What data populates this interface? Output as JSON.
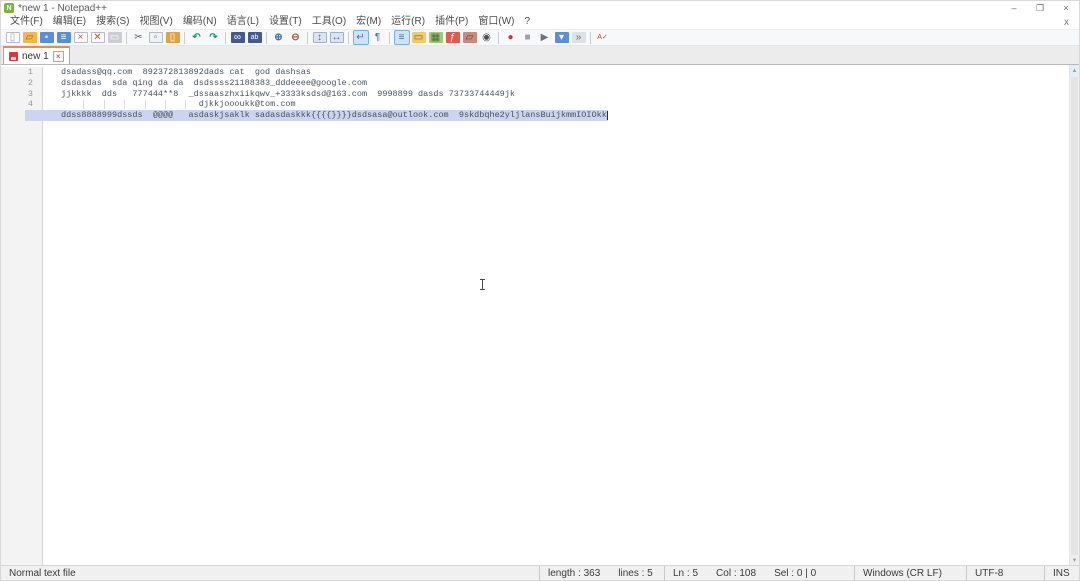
{
  "window": {
    "title": "*new 1 - Notepad++",
    "controls": {
      "minimize": "–",
      "restore": "❐",
      "close": "×"
    }
  },
  "menubar": {
    "items": [
      {
        "id": "file",
        "label": "文件(F)"
      },
      {
        "id": "edit",
        "label": "编辑(E)"
      },
      {
        "id": "search",
        "label": "搜索(S)"
      },
      {
        "id": "view",
        "label": "视图(V)"
      },
      {
        "id": "encoding",
        "label": "编码(N)"
      },
      {
        "id": "language",
        "label": "语言(L)"
      },
      {
        "id": "settings",
        "label": "设置(T)"
      },
      {
        "id": "tools",
        "label": "工具(O)"
      },
      {
        "id": "macro",
        "label": "宏(M)"
      },
      {
        "id": "run",
        "label": "运行(R)"
      },
      {
        "id": "plugins",
        "label": "插件(P)"
      },
      {
        "id": "window",
        "label": "窗口(W)"
      },
      {
        "id": "help",
        "label": "?"
      }
    ],
    "doc_close": "x"
  },
  "toolbar": {
    "pressed_bg": "#cfe3f7",
    "pressed_border": "#7ab0e0",
    "icons": [
      {
        "id": "new-file",
        "glyph": "▯",
        "fg": "#9aa1ab",
        "bg": "#fdfdfd",
        "border": "#b6bcc6"
      },
      {
        "id": "open-folder",
        "glyph": "▱",
        "fg": "#8a6420",
        "bg": "#f3b64c"
      },
      {
        "id": "save",
        "glyph": "▪",
        "fg": "#cfe0f5",
        "bg": "#5b8dd9",
        "disabled": false
      },
      {
        "id": "save-all",
        "glyph": "≡",
        "fg": "#ffffff",
        "bg": "#5b8dd9"
      },
      {
        "id": "close",
        "glyph": "×",
        "fg": "#d44a3a",
        "bg": "#fdfdfd",
        "border": "#b6bcc6"
      },
      {
        "id": "close-all",
        "glyph": "✕",
        "fg": "#d44a3a",
        "bg": "#fdfdfd",
        "border": "#b6bcc6"
      },
      {
        "id": "print",
        "glyph": "▭",
        "fg": "#ffffff",
        "bg": "#c9cdd4"
      },
      {
        "sep": true
      },
      {
        "id": "cut",
        "glyph": "✂",
        "fg": "#5a6068"
      },
      {
        "id": "copy",
        "glyph": "▫",
        "fg": "#7a828c",
        "bg": "#eef2f7",
        "border": "#b6bcc6"
      },
      {
        "id": "paste",
        "glyph": "▯",
        "fg": "#ffffff",
        "bg": "#e2a23f"
      },
      {
        "sep": true
      },
      {
        "id": "undo",
        "glyph": "↶",
        "fg": "#1c9e63",
        "bold": true
      },
      {
        "id": "redo",
        "glyph": "↷",
        "fg": "#1c9e63",
        "bold": true
      },
      {
        "sep": true
      },
      {
        "id": "find",
        "glyph": "∞",
        "fg": "#ffffff",
        "bg": "#44598f"
      },
      {
        "id": "replace",
        "glyph": "ab",
        "fg": "#ffffff",
        "bg": "#44598f",
        "small": true
      },
      {
        "sep": true
      },
      {
        "id": "zoom-in",
        "glyph": "⊕",
        "fg": "#3f6fae",
        "bold": true
      },
      {
        "id": "zoom-out",
        "glyph": "⊖",
        "fg": "#b05a4a",
        "bold": true
      },
      {
        "sep": true
      },
      {
        "id": "sync-scroll-vertical",
        "glyph": "↕",
        "fg": "#3f6fae",
        "bg": "#dbe4f0",
        "border": "#9fb2cc"
      },
      {
        "id": "sync-scroll-horizontal",
        "glyph": "↔",
        "fg": "#3f6fae",
        "bg": "#dbe4f0",
        "border": "#9fb2cc"
      },
      {
        "sep": true
      },
      {
        "id": "word-wrap",
        "glyph": "↵",
        "fg": "#3f6fae",
        "pressed": true
      },
      {
        "id": "show-all-characters",
        "glyph": "¶",
        "fg": "#3f6fae"
      },
      {
        "sep": true
      },
      {
        "id": "show-indent-guide",
        "glyph": "≡",
        "fg": "#3f6fae",
        "pressed": true
      },
      {
        "id": "user-define-dialog",
        "glyph": "▭",
        "fg": "#7a5a1e",
        "bg": "#f0c96a"
      },
      {
        "id": "document-map",
        "glyph": "▦",
        "fg": "#4a6a30",
        "bg": "#9fc87a"
      },
      {
        "id": "function-list",
        "glyph": "ƒ",
        "fg": "#ffffff",
        "bg": "#e05a4e"
      },
      {
        "id": "folder-as-workspace",
        "glyph": "▱",
        "fg": "#6a3a30",
        "bg": "#c98a7a"
      },
      {
        "id": "monitoring-eye",
        "glyph": "◉",
        "fg": "#4a4f56"
      },
      {
        "sep": true
      },
      {
        "id": "macro-record",
        "glyph": "●",
        "fg": "#c43b3b"
      },
      {
        "id": "macro-stop",
        "glyph": "■",
        "fg": "#9aa0a8"
      },
      {
        "id": "macro-play",
        "glyph": "▶",
        "fg": "#6a7280"
      },
      {
        "id": "macro-save",
        "glyph": "▾",
        "fg": "#ffffff",
        "bg": "#5b8dd9"
      },
      {
        "id": "macro-run-multiple",
        "glyph": "»",
        "fg": "#6a7280",
        "bg": "#dde1e6"
      },
      {
        "sep": true
      },
      {
        "id": "spell-check",
        "glyph": "A✓",
        "fg": "#b5493f",
        "small": true
      }
    ]
  },
  "tabbar": {
    "tabs": [
      {
        "label": "new 1",
        "modified": true,
        "close": "×"
      }
    ],
    "active_tab_accent": "#e78a5a"
  },
  "editor": {
    "line_numbers": [
      "1",
      "2",
      "3",
      "4",
      "5"
    ],
    "lines": [
      "dsadass@qq.com  892372813892dads cat  god dashsas",
      "dsdasdas  sda qing da da  dsdssss21188383_dddeeee@google.com",
      "jjkkkk  dds   777444**8  _dssaaszhxiikqwv_+3333ksdsd@163.com  9998899 dasds 73733744449jk",
      "                           djkkjoooukk@tom.com",
      "ddss8888999dssds  @@@@   asdaskjsaklk sadasdaskkk{{{{}}}}dsdsasa@outlook.com  9skdbqhe2yljlansBuijkmmIOIOkk"
    ],
    "caret_line": 5,
    "caret_line_color": "#cbd4f0",
    "text_color": "#47525f",
    "mouse_cursor": "i-beam"
  },
  "statusbar": {
    "doc_type": "Normal text file",
    "length_label": "length : 363",
    "lines_label": "lines : 5",
    "ln_label": "Ln : 5",
    "col_label": "Col : 108",
    "sel_label": "Sel : 0 | 0",
    "eol": "Windows (CR LF)",
    "encoding": "UTF-8",
    "insert_mode": "INS"
  }
}
